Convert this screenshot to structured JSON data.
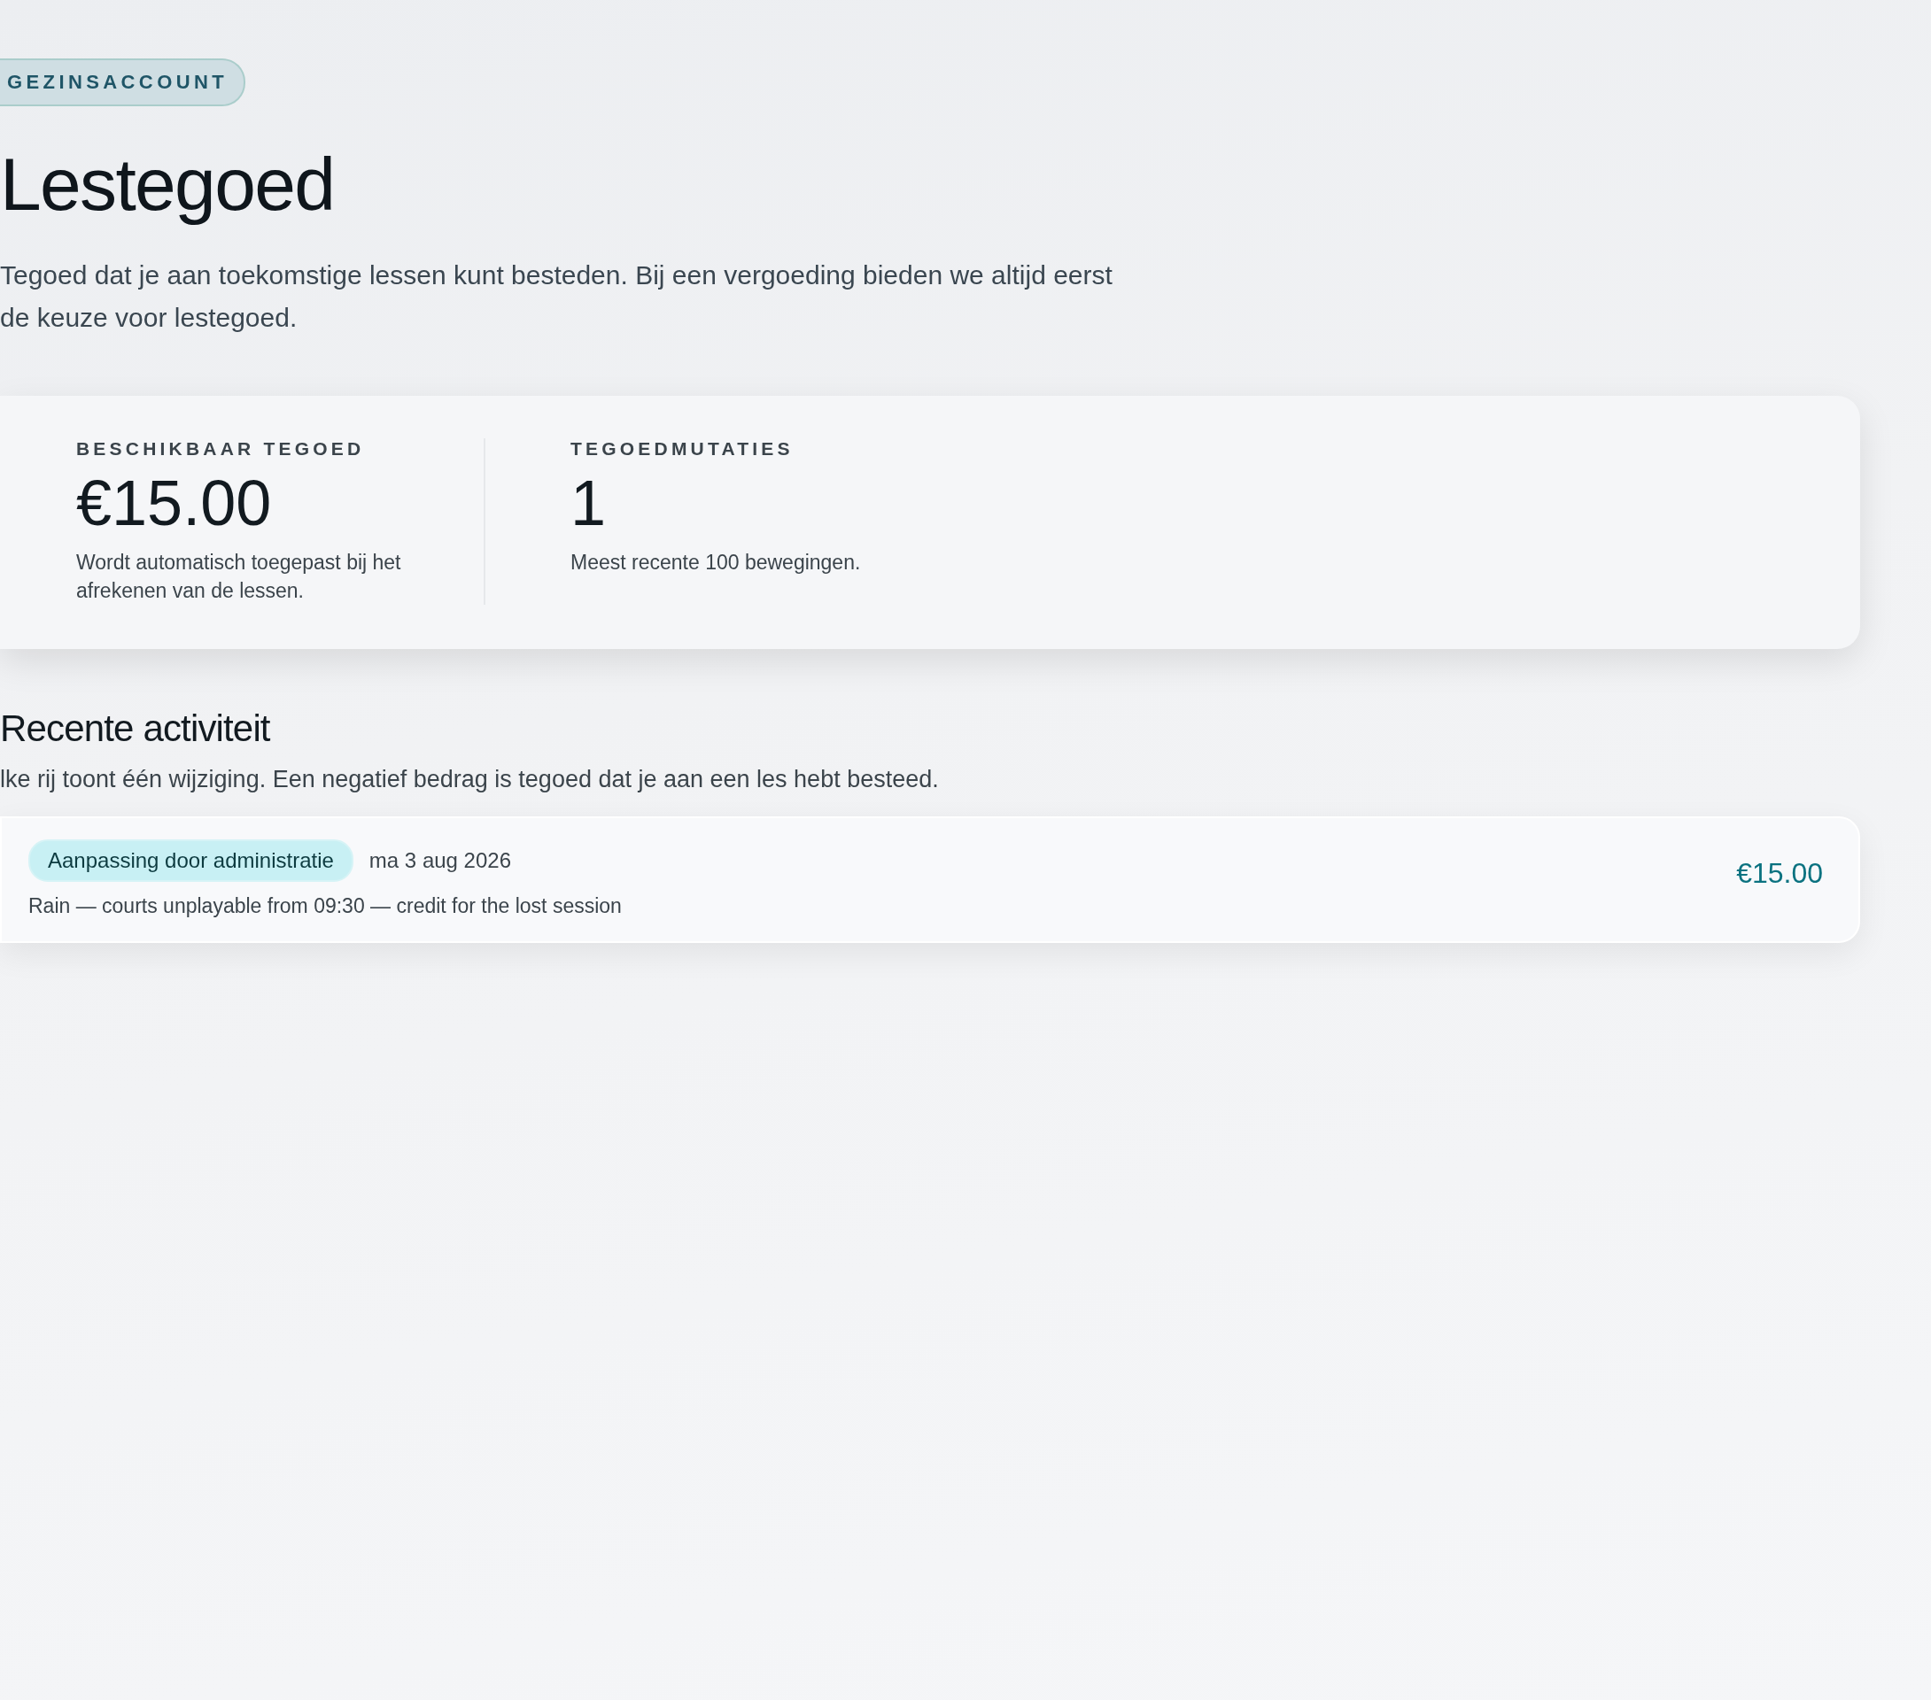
{
  "badge": "GEZINSACCOUNT",
  "title": "Lestegoed",
  "intro": "Tegoed dat je aan toekomstige lessen kunt besteden. Bij een vergoeding bieden we altijd eerst de keuze voor lestegoed.",
  "stats": [
    {
      "label": "BESCHIKBAAR TEGOED",
      "value": "€15.00",
      "note": "Wordt automatisch toegepast bij het afrekenen van de lessen."
    },
    {
      "label": "TEGOEDMUTATIES",
      "value": "1",
      "note": "Meest recente 100 bewegingen."
    }
  ],
  "activity": {
    "heading": "Recente activiteit",
    "subtitle": "lke rij toont één wijziging. Een negatief bedrag is tegoed dat je aan een les hebt besteed.",
    "rows": [
      {
        "tag": "Aanpassing door administratie",
        "date": "ma 3 aug 2026",
        "description": "Rain — courts unplayable from 09:30 — credit for the lost session",
        "amount": "€15.00",
        "kind": "credit"
      }
    ]
  }
}
